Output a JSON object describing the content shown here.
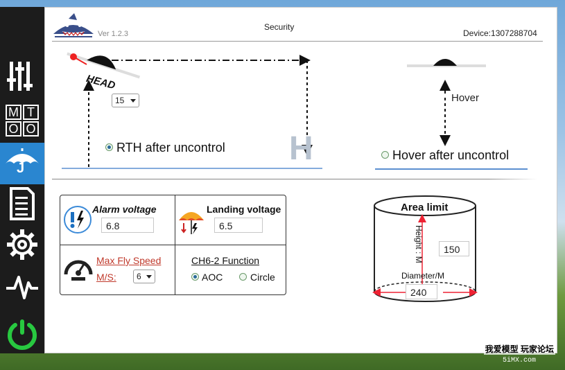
{
  "header": {
    "version": "Ver 1.2.3",
    "title": "Security",
    "device": "Device:1307288704"
  },
  "sidebar": {
    "items": [
      {
        "name": "sliders",
        "icon": "sliders-icon"
      },
      {
        "name": "mode",
        "icon": "mode-grid-icon",
        "glyphs": [
          "M",
          "T",
          "O",
          "O"
        ]
      },
      {
        "name": "security",
        "icon": "umbrella-icon",
        "active": true,
        "glyph": "J"
      },
      {
        "name": "log",
        "icon": "document-icon"
      },
      {
        "name": "settings",
        "icon": "gear-icon"
      },
      {
        "name": "monitor",
        "icon": "pulse-icon"
      },
      {
        "name": "power",
        "icon": "power-icon"
      }
    ],
    "active_color": "#2a86d0",
    "power_color": "#28c840"
  },
  "rth": {
    "head_label": "HEAD",
    "height_select": "15",
    "option_label": "RTH after uncontrol",
    "selected": true,
    "landing_glyph": "H"
  },
  "hover": {
    "label": "Hover",
    "option_label": "Hover after uncontrol",
    "selected": false
  },
  "voltage": {
    "alarm_label": "Alarm voltage",
    "alarm_value": "6.8",
    "landing_label": "Landing voltage",
    "landing_value": "6.5",
    "max_speed_label_1": "Max Fly Speed",
    "max_speed_label_2": "M/S:",
    "max_speed_value": "6",
    "ch_function_label": "CH6-2 Function",
    "aoc_label": "AOC",
    "circle_label": "Circle",
    "aoc_selected": true
  },
  "area": {
    "title": "Area limit",
    "height_label": "Height : M",
    "height_value": "150",
    "diameter_label": "Diameter/M",
    "diameter_value": "240"
  },
  "watermark": {
    "text": "我爱模型 玩家论坛",
    "sub": "5iMX.com"
  }
}
